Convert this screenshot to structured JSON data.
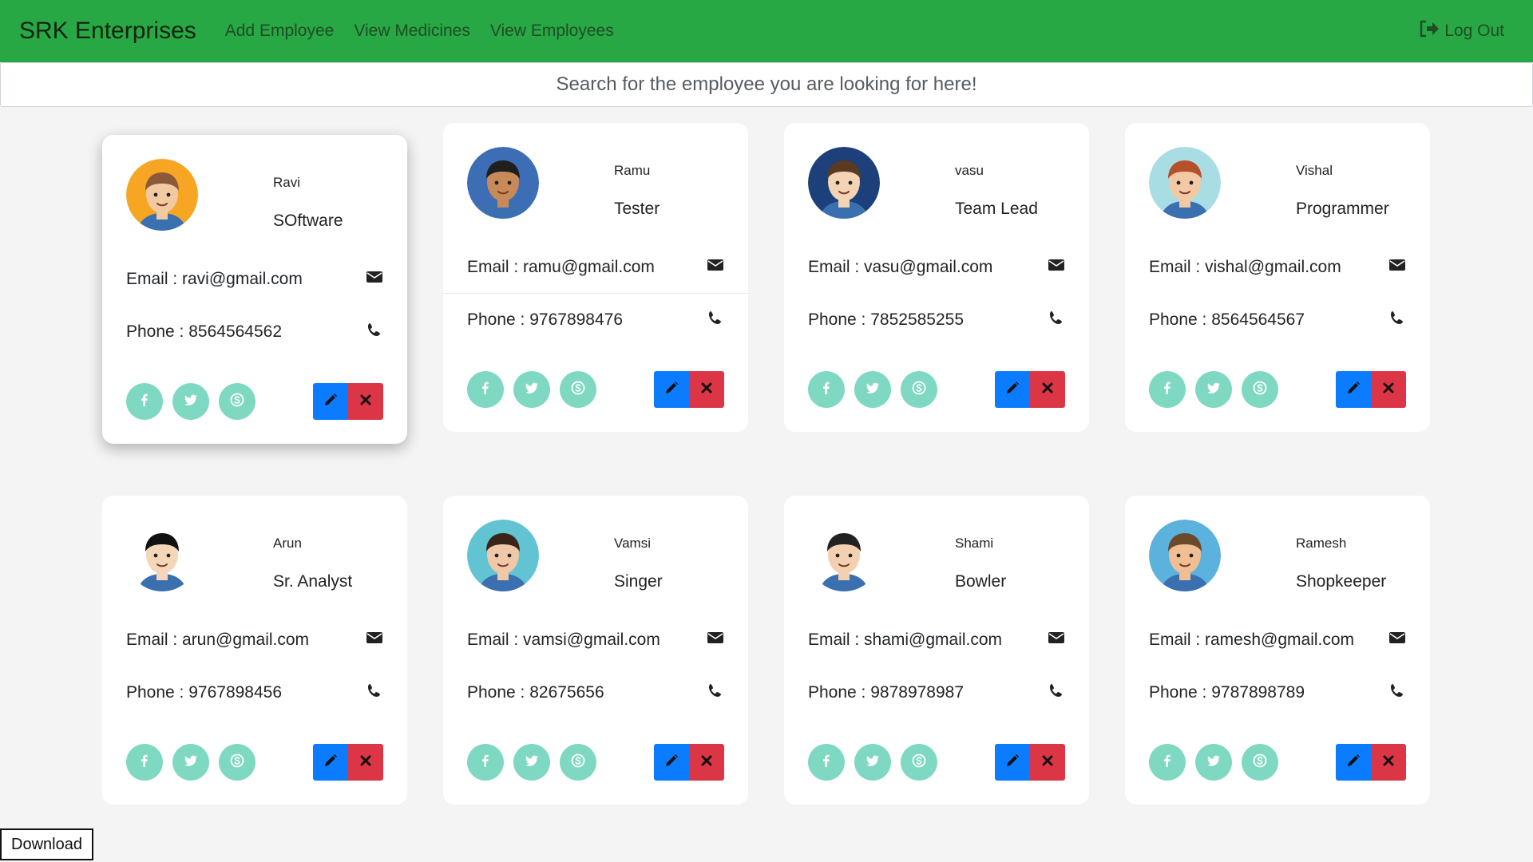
{
  "navbar": {
    "brand": "SRK Enterprises",
    "links": [
      "Add Employee",
      "View Medicines",
      "View Employees"
    ],
    "logout": "Log Out"
  },
  "search": {
    "placeholder": "Search for the employee you are looking for here!"
  },
  "colors": {
    "navbar": "#28a745",
    "social": "#7fd8c2",
    "edit": "#0b7cff",
    "delete": "#dc3545"
  },
  "employees": [
    {
      "name": "Ravi",
      "role": "SOftware",
      "email": "Email : ravi@gmail.com",
      "phone": "Phone : 8564564562",
      "avatar_bg": "#f6a623",
      "hair": "#8a5a3b",
      "skin": "#f2c9a1"
    },
    {
      "name": "Ramu",
      "role": "Tester",
      "email": "Email : ramu@gmail.com",
      "phone": "Phone : 9767898476",
      "avatar_bg": "#3d6db5",
      "hair": "#1f1f1f",
      "skin": "#c98a5a"
    },
    {
      "name": "vasu",
      "role": "Team Lead",
      "email": "Email : vasu@gmail.com",
      "phone": "Phone : 7852585255",
      "avatar_bg": "#1d3f7a",
      "hair": "#5a3a20",
      "skin": "#f5d3b5"
    },
    {
      "name": "Vishal",
      "role": "Programmer",
      "email": "Email : vishal@gmail.com",
      "phone": "Phone : 8564564567",
      "avatar_bg": "#a9dde4",
      "hair": "#b5502a",
      "skin": "#f3c9a5"
    },
    {
      "name": "Arun",
      "role": "Sr. Analyst",
      "email": "Email : arun@gmail.com",
      "phone": "Phone : 9767898456",
      "avatar_bg": "#ffffff",
      "hair": "#111111",
      "skin": "#f4d7b8"
    },
    {
      "name": "Vamsi",
      "role": "Singer",
      "email": "Email : vamsi@gmail.com",
      "phone": "Phone : 82675656",
      "avatar_bg": "#62c3d3",
      "hair": "#3a2418",
      "skin": "#f0c8a8"
    },
    {
      "name": "Shami",
      "role": "Bowler",
      "email": "Email : shami@gmail.com",
      "phone": "Phone : 9878978987",
      "avatar_bg": "#ffffff",
      "hair": "#222222",
      "skin": "#f3d1b0"
    },
    {
      "name": "Ramesh",
      "role": "Shopkeeper",
      "email": "Email : ramesh@gmail.com",
      "phone": "Phone : 9787898789",
      "avatar_bg": "#5bb2dc",
      "hair": "#6b4a2b",
      "skin": "#efbe92"
    }
  ],
  "download": "Download"
}
